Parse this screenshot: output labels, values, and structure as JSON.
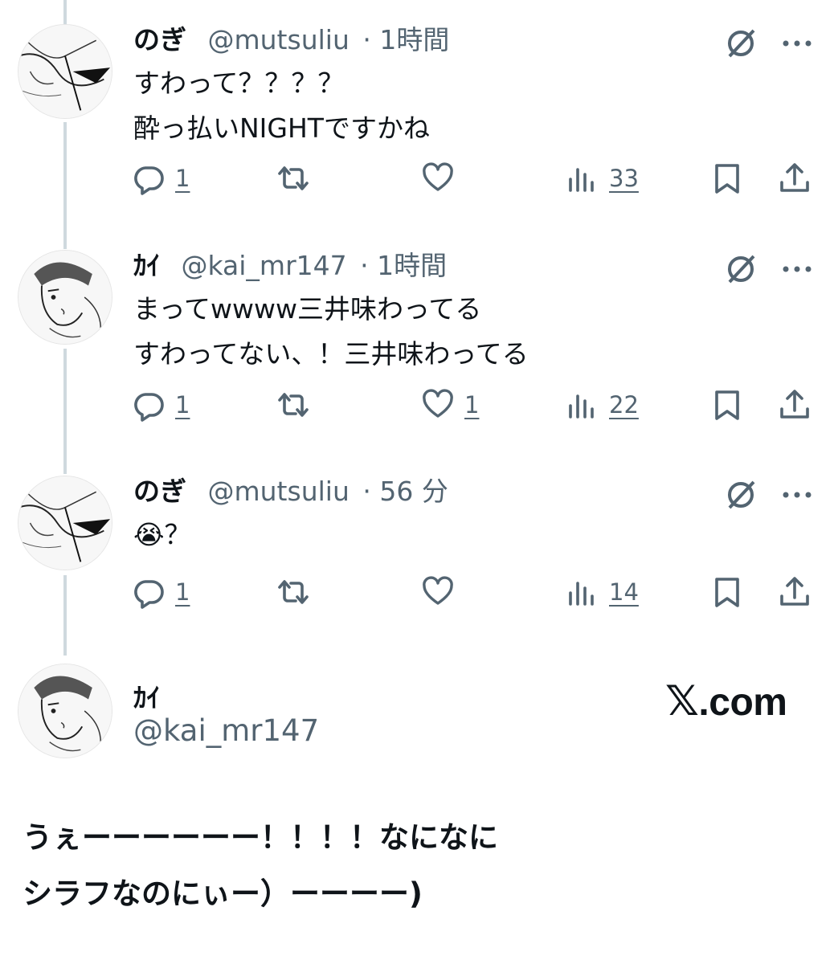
{
  "tweets": [
    {
      "name": "のぎ",
      "handle": "@mutsuliu",
      "time": "· 1時間",
      "lines": [
        "すわって？？？？",
        "酔っ払いNIGHTですかね"
      ],
      "replies": "1",
      "retweets": "",
      "likes": "",
      "views": "33",
      "avatar_icon": "avatar-manga-nogi"
    },
    {
      "name": "ｶｲ",
      "handle": "@kai_mr147",
      "time": "· 1時間",
      "lines": [
        "まってwwww三井味わってる",
        "すわってない、！三井味わってる"
      ],
      "replies": "1",
      "retweets": "",
      "likes": "1",
      "views": "22",
      "avatar_icon": "avatar-manga-kai"
    },
    {
      "name": "のぎ",
      "handle": "@mutsuliu",
      "time": "· 56 分",
      "lines": [
        "😭？"
      ],
      "replies": "1",
      "retweets": "",
      "likes": "",
      "views": "14",
      "avatar_icon": "avatar-manga-nogi"
    }
  ],
  "main_post": {
    "name": "ｶｲ",
    "handle": "@kai_mr147",
    "brand_mark": "𝕏",
    "brand_text": ".com",
    "lines": [
      "うぇーーーーーー！！！！なになに",
      "シラフなのにぃー）ーーーー)"
    ]
  },
  "icons": {
    "grok": "grok-icon",
    "more": "more-dots-icon",
    "reply": "reply-bubble-icon",
    "retweet": "retweet-icon",
    "like": "heart-icon",
    "views": "views-bar-icon",
    "bookmark": "bookmark-icon",
    "share": "share-icon"
  },
  "colors": {
    "text": "#0f1419",
    "secondary": "#536471",
    "thread_line": "#cfd9de"
  }
}
